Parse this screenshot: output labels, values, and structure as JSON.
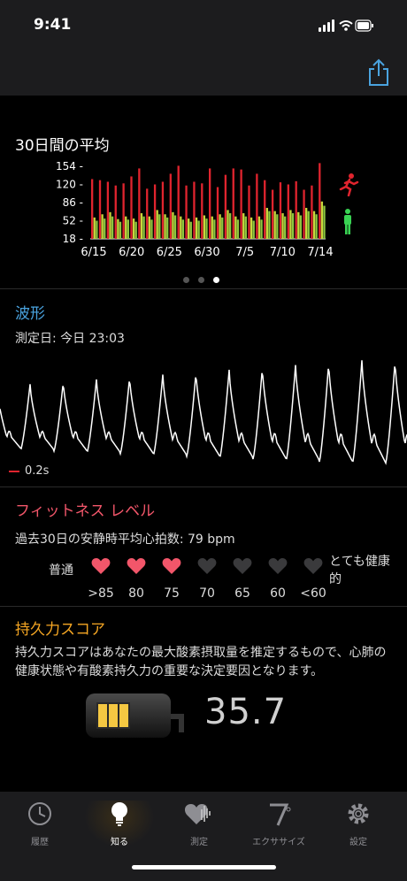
{
  "status": {
    "time": "9:41"
  },
  "average": {
    "title": "30日間の平均",
    "y_ticks": [
      "154",
      "120",
      "86",
      "52",
      "18"
    ],
    "x_ticks": [
      "6/15",
      "6/20",
      "6/25",
      "6/30",
      "7/5",
      "7/10",
      "7/14"
    ],
    "page_dots": 3,
    "active_dot": 2
  },
  "chart_data": {
    "type": "bar",
    "title": "30日間の平均",
    "ylim": [
      18,
      154
    ],
    "yticks": [
      18,
      52,
      86,
      120,
      154
    ],
    "x_labels": [
      "6/15",
      "6/20",
      "6/25",
      "6/30",
      "7/5",
      "7/10",
      "7/14"
    ],
    "series": [
      {
        "color": "#e0242e",
        "values": [
          130,
          128,
          125,
          118,
          122,
          135,
          150,
          112,
          120,
          125,
          140,
          155,
          118,
          125,
          122,
          150,
          115,
          138,
          150,
          148,
          118,
          140,
          128,
          110,
          124,
          120,
          126,
          110,
          118,
          160
        ]
      },
      {
        "color": "#c8d83c",
        "values": [
          58,
          64,
          68,
          55,
          60,
          56,
          66,
          60,
          72,
          64,
          68,
          60,
          56,
          58,
          62,
          60,
          64,
          72,
          60,
          66,
          58,
          60,
          76,
          70,
          66,
          72,
          68,
          76,
          70,
          88
        ]
      },
      {
        "color": "#8dc63f",
        "values": [
          52,
          56,
          60,
          50,
          54,
          50,
          60,
          54,
          64,
          58,
          62,
          54,
          50,
          52,
          56,
          54,
          58,
          66,
          54,
          60,
          52,
          54,
          70,
          64,
          60,
          66,
          62,
          70,
          64,
          80
        ]
      }
    ]
  },
  "waveform": {
    "title": "波形",
    "measured": "測定日: 今日 23:03",
    "scale": "0.2s"
  },
  "fitness": {
    "title": "フィットネス レベル",
    "subtitle": "過去30日の安静時平均心拍数: 79 bpm",
    "left_label": "普通",
    "right_label": "とても健康的",
    "levels": [
      ">85",
      "80",
      "75",
      "70",
      "65",
      "60",
      "<60"
    ],
    "filled_count": 3,
    "filled_color": "#f2566a",
    "empty_color": "#3a3a3c"
  },
  "endurance": {
    "title": "持久力スコア",
    "description": "持久力スコアはあなたの最大酸素摂取量を推定するもので、心肺の健康状態や有酸素持久力の重要な決定要因となります。",
    "score": "35.7",
    "bars_filled": 3
  },
  "colors": {
    "accent_blue": "#4aa3df",
    "accent_red": "#f2566a",
    "accent_orange": "#f5a623",
    "resting_green": "#39d353",
    "active_red": "#e0242e"
  },
  "tabs": [
    {
      "label": "履歴",
      "icon": "clock-icon"
    },
    {
      "label": "知る",
      "icon": "lightbulb-icon",
      "active": true
    },
    {
      "label": "測定",
      "icon": "heart-wave-icon"
    },
    {
      "label": "エクササイズ",
      "icon": "seven-icon"
    },
    {
      "label": "設定",
      "icon": "gear-icon"
    }
  ]
}
